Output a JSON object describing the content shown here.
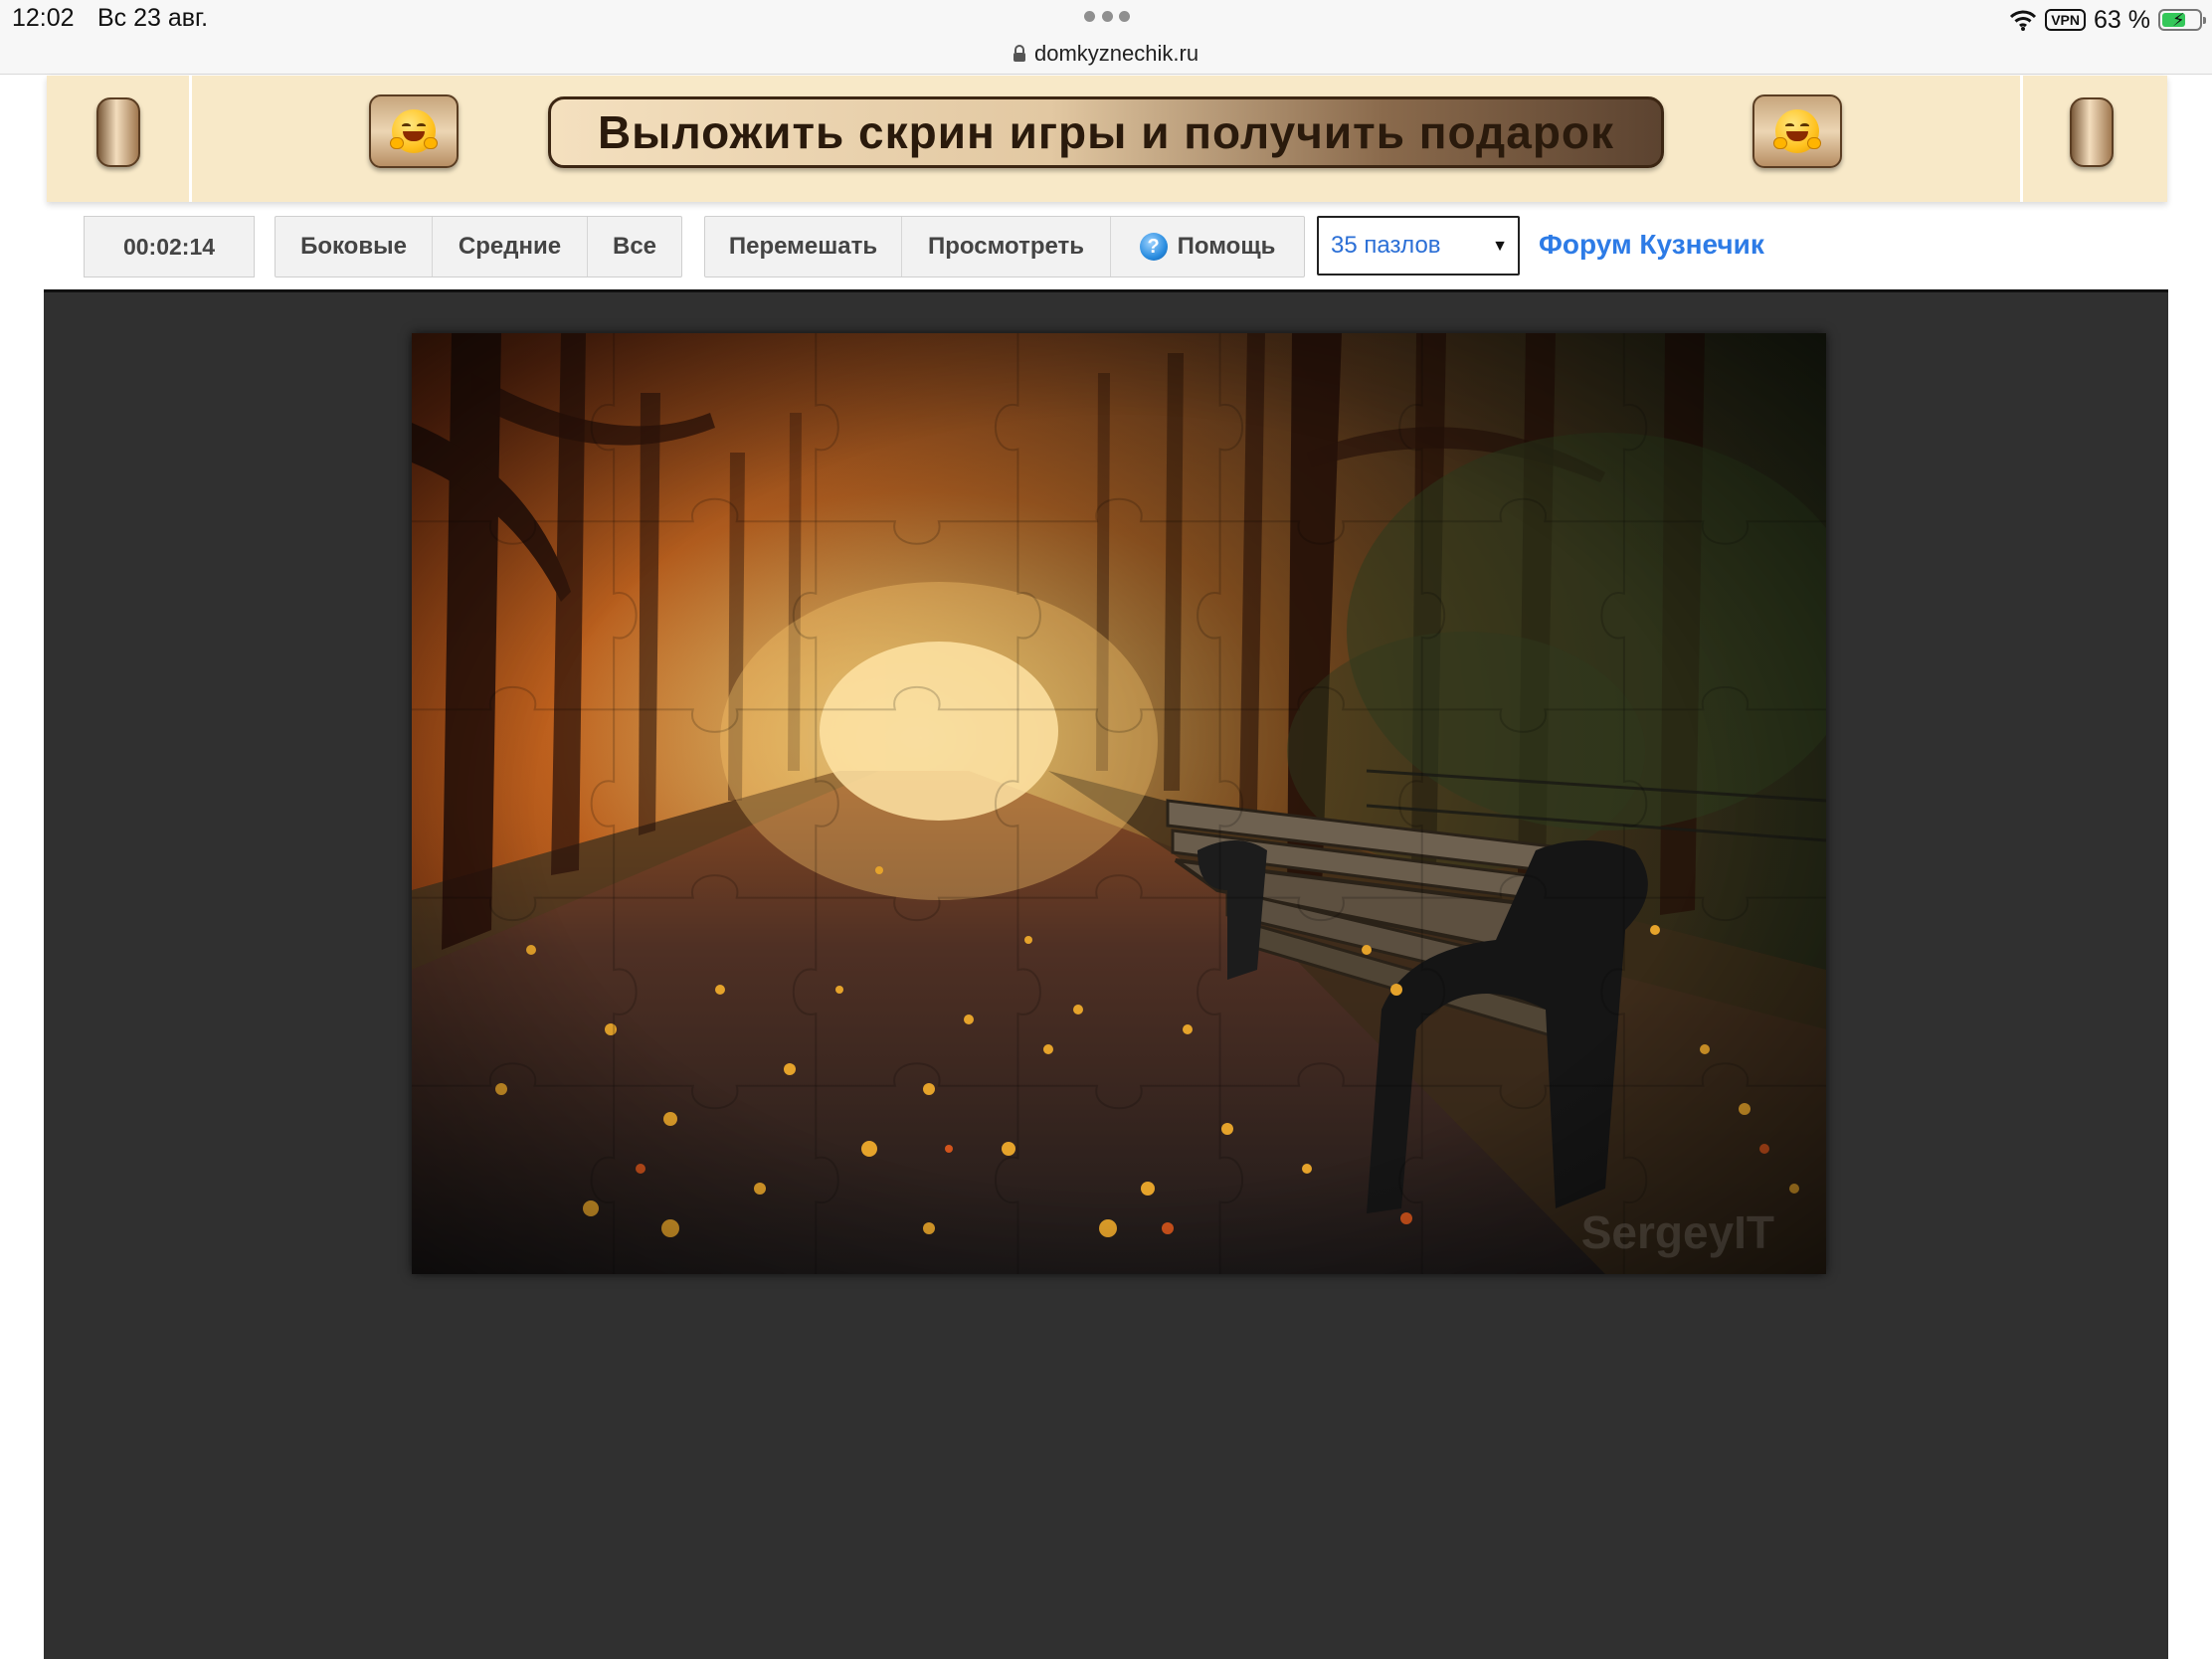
{
  "status_bar": {
    "time": "12:02",
    "date": "Вс 23 авг.",
    "url": "domkyznechik.ru",
    "vpn": "VPN",
    "battery": "63 %",
    "battery_level": 0.63
  },
  "banner": {
    "title": "Выложить скрин игры и получить подарок",
    "emoji_icon": "hugging-face-icon"
  },
  "toolbar": {
    "timer": "00:02:14",
    "filter_buttons": [
      "Боковые",
      "Средние",
      "Все"
    ],
    "action_buttons": {
      "shuffle": "Перемешать",
      "preview": "Просмотреть",
      "help": "Помощь"
    },
    "pieces_select": "35 пазлов",
    "forum_link": "Форум Кузнечик"
  },
  "puzzle": {
    "watermark": "SergeyIT",
    "grid": {
      "columns": 7,
      "rows": 5
    },
    "colors": {
      "background": "#303030",
      "glow": "#ffd27a",
      "sky": "#b3541a",
      "leaves": "#e9a326"
    }
  }
}
